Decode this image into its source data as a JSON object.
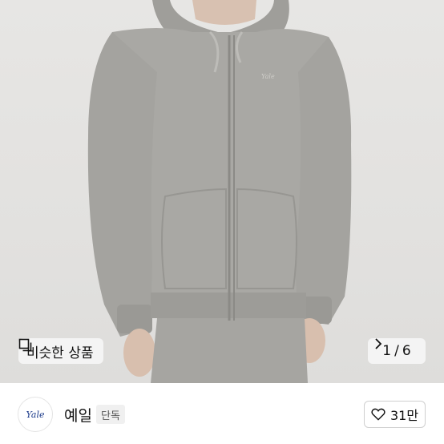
{
  "gallery": {
    "similar_label": "비슷한 상품",
    "current_index": "1",
    "separator": "/",
    "total": "6"
  },
  "seller": {
    "avatar_text": "Yale",
    "name": "예일",
    "badge": "단독"
  },
  "like": {
    "count": "31만"
  },
  "colors": {
    "hoodie": "#a9a8a4",
    "background": "#e3e2e0"
  }
}
